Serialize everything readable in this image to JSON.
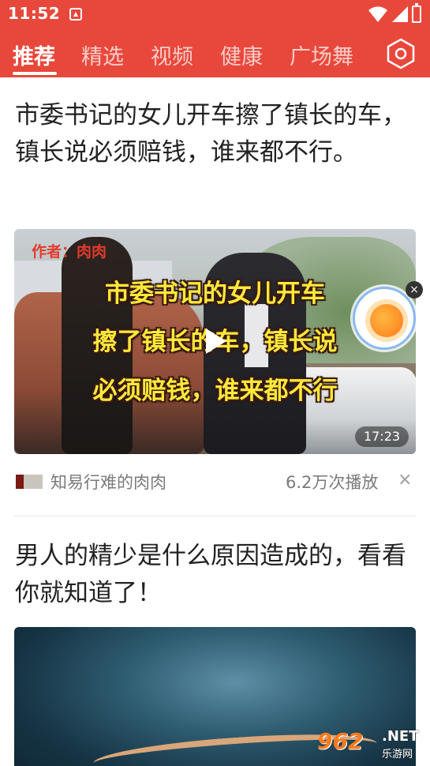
{
  "status_bar": {
    "time": "11:52",
    "icons": [
      "notification-icon",
      "wifi-icon",
      "signal-icon",
      "battery-icon"
    ]
  },
  "nav": {
    "tabs": [
      {
        "label": "推荐",
        "active": true
      },
      {
        "label": "精选",
        "active": false
      },
      {
        "label": "视频",
        "active": false
      },
      {
        "label": "健康",
        "active": false
      },
      {
        "label": "广场舞",
        "active": false
      }
    ],
    "settings_icon": "settings-hexagon-icon",
    "accent_color": "#e8483b"
  },
  "feed": {
    "articles": [
      {
        "title": "市委书记的女儿开车擦了镇长的车，镇长说必须赔钱，谁来都不行。",
        "thumbnail": {
          "author_tag": "作者：肉肉",
          "overlay_lines": [
            "市委书记的女儿开车",
            "擦了镇长的车，镇长说",
            "必须赔钱，谁来都不行"
          ],
          "duration": "17:23"
        },
        "source": "知易行难的肉肉",
        "play_count": "6.2万次播放",
        "dismiss": "×"
      },
      {
        "title": "男人的精少是什么原因造成的，看看你就知道了！"
      }
    ]
  },
  "floating_widget": {
    "icon": "sun-weather-icon",
    "close": "×"
  },
  "watermark": {
    "logo": "962",
    "net": ".NET",
    "sub": "乐游网"
  }
}
